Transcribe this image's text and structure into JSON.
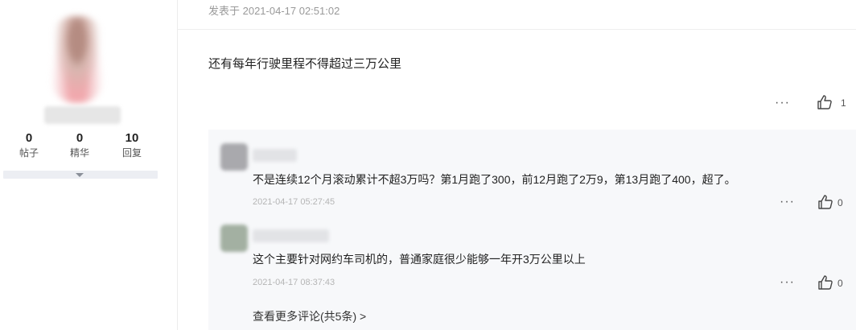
{
  "user": {
    "stats": [
      {
        "value": "0",
        "label": "帖子"
      },
      {
        "value": "0",
        "label": "精华"
      },
      {
        "value": "10",
        "label": "回复"
      }
    ]
  },
  "post": {
    "timestamp": "发表于 2021-04-17 02:51:02",
    "content": "还有每年行驶里程不得超过三万公里",
    "more": "···",
    "likes": "1"
  },
  "comments": [
    {
      "text": "不是连续12个月滚动累计不超3万吗？第1月跑了300，前12月跑了2万9，第13月跑了400，超了。",
      "time": "2021-04-17 05:27:45",
      "more": "···",
      "likes": "0"
    },
    {
      "text": "这个主要针对网约车司机的，普通家庭很少能够一年开3万公里以上",
      "time": "2021-04-17 08:37:43",
      "more": "···",
      "likes": "0"
    }
  ],
  "view_more": "查看更多评论(共5条) >",
  "icons": [
    "thumbs-up-icon",
    "more-icon",
    "chevron-down-icon"
  ]
}
